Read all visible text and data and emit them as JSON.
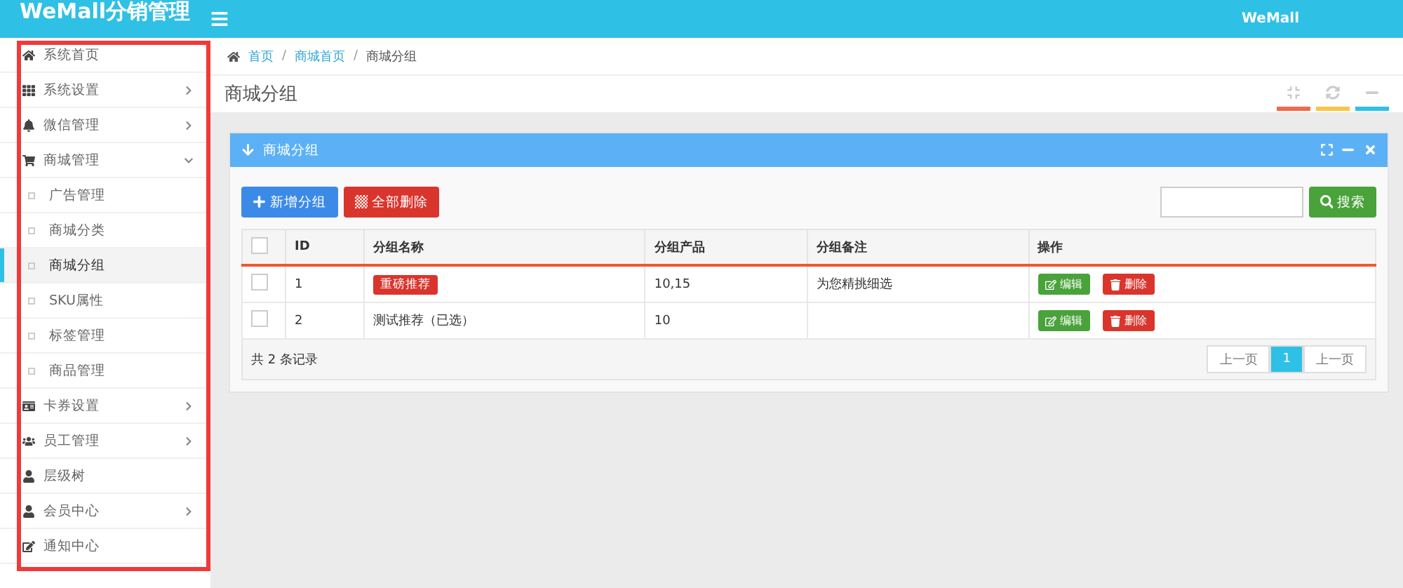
{
  "header": {
    "title": "WeMall分销管理",
    "user": "WeMall"
  },
  "sidebar": {
    "items": [
      {
        "label": "系统首页",
        "has_arrow": false,
        "selected": false
      },
      {
        "label": "系统设置",
        "has_arrow": true,
        "selected": false
      },
      {
        "label": "微信管理",
        "has_arrow": true,
        "selected": false
      },
      {
        "label": "商城管理",
        "has_arrow": true,
        "expanded": true,
        "selected": false,
        "children": [
          {
            "label": "广告管理",
            "selected": false
          },
          {
            "label": "商城分类",
            "selected": false
          },
          {
            "label": "商城分组",
            "selected": true
          },
          {
            "label": "SKU属性",
            "selected": false
          },
          {
            "label": "标签管理",
            "selected": false
          },
          {
            "label": "商品管理",
            "selected": false
          }
        ]
      },
      {
        "label": "卡券设置",
        "has_arrow": true,
        "selected": false
      },
      {
        "label": "员工管理",
        "has_arrow": true,
        "selected": false
      },
      {
        "label": "层级树",
        "has_arrow": false,
        "selected": false
      },
      {
        "label": "会员中心",
        "has_arrow": true,
        "selected": false
      },
      {
        "label": "通知中心",
        "has_arrow": false,
        "selected": false
      }
    ]
  },
  "breadcrumb": [
    {
      "label": "首页",
      "kind": "link"
    },
    {
      "label": "/",
      "kind": "separator"
    },
    {
      "label": "商城首页",
      "kind": "link"
    },
    {
      "label": "/",
      "kind": "separator"
    },
    {
      "label": "商城分组",
      "kind": "current"
    }
  ],
  "page_title": "商城分组",
  "panel": {
    "title": "商城分组",
    "buttons": [
      {
        "label": "新增分组",
        "kind": "add"
      },
      {
        "label": "全部删除",
        "kind": "delete"
      }
    ],
    "search": {
      "button": "搜索"
    },
    "table": {
      "all_checked": false,
      "columns": [
        "ID",
        "分组名称",
        "分组产品",
        "分组备注",
        "操作"
      ],
      "rows": [
        {
          "checked": false,
          "id": "1",
          "name": "重磅推荐",
          "kind": "badge",
          "products": "10,15",
          "note": "为您精挑细选",
          "actions": [
            "编辑",
            "删除"
          ]
        },
        {
          "checked": false,
          "id": "2",
          "name": "测试推荐（已选）",
          "kind": "text",
          "products": "10",
          "note": "",
          "actions": [
            "编辑",
            "删除"
          ]
        }
      ]
    },
    "footer": {
      "count": "共 2 条记录",
      "pages": [
        {
          "label": "上一页",
          "selected": false
        },
        {
          "label": "1",
          "selected": true
        },
        {
          "label": "上一页",
          "selected": false
        }
      ]
    }
  }
}
